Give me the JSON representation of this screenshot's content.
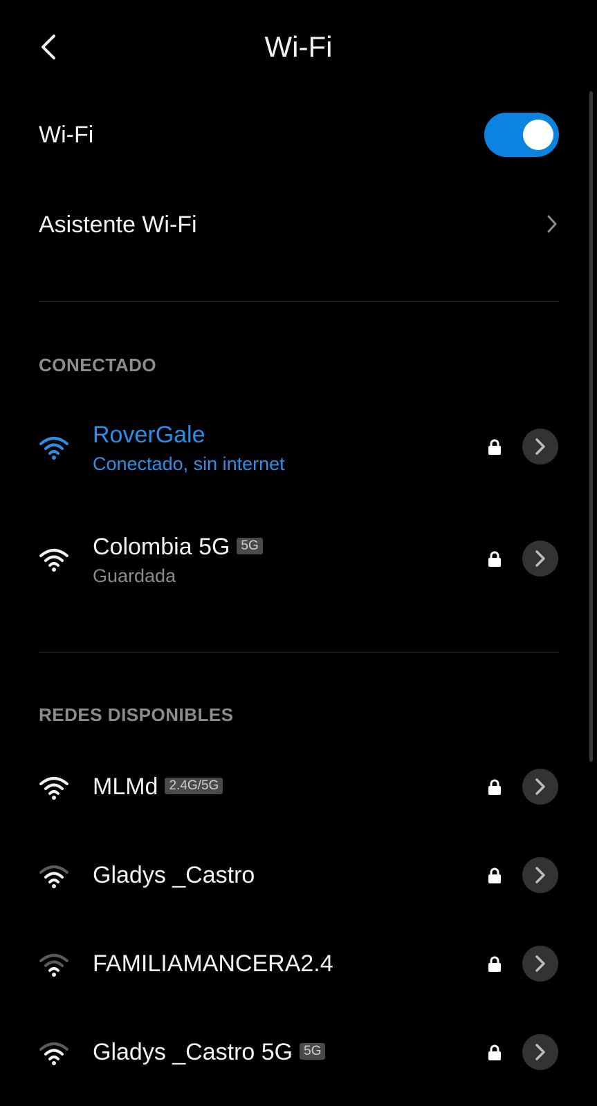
{
  "header": {
    "title": "Wi-Fi",
    "back_icon": "chevron-left-icon"
  },
  "wifi_toggle": {
    "label": "Wi-Fi",
    "enabled": true,
    "accent_color": "#0a84e0"
  },
  "assistant": {
    "label": "Asistente Wi-Fi",
    "icon": "chevron-right-icon"
  },
  "connected_section": {
    "header": "CONECTADO",
    "networks": [
      {
        "name": "RoverGale",
        "status": "Conectado, sin internet",
        "badge": "",
        "secured": true,
        "color": "#2b8fe8"
      },
      {
        "name": "Colombia 5G",
        "status": "Guardada",
        "badge": "5G",
        "secured": true
      }
    ]
  },
  "available_section": {
    "header": "REDES DISPONIBLES",
    "networks": [
      {
        "name": "MLMd",
        "badge": "2.4G/5G",
        "secured": true
      },
      {
        "name": "Gladys _Castro",
        "badge": "",
        "secured": true
      },
      {
        "name": "FAMILIAMANCERA2.4",
        "badge": "",
        "secured": true
      },
      {
        "name": "Gladys _Castro 5G",
        "badge": "5G",
        "secured": true
      }
    ]
  }
}
